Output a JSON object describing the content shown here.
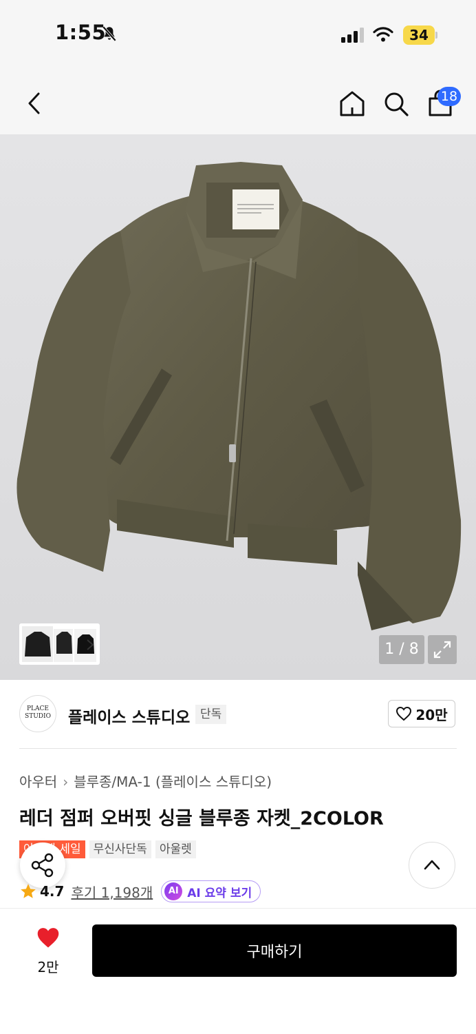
{
  "status_bar": {
    "time": "1:55",
    "battery": "34"
  },
  "nav": {
    "cart_count": "18",
    "icons": [
      "back-icon",
      "home-icon",
      "search-icon",
      "cart-icon"
    ]
  },
  "gallery": {
    "counter": "1 / 8"
  },
  "brand": {
    "name": "플레이스 스튜디오",
    "tag": "단독",
    "likes": "20만",
    "logo_text": "PLACE STUDIO"
  },
  "breadcrumb": {
    "category": "아우터",
    "subcategory": "블루종/MA-1 (플레이스 스튜디오)"
  },
  "product": {
    "title": "레더 점퍼 오버핏 싱글 블루종 자켓_2COLOR",
    "tags": [
      "아울렛 세일",
      "무신사단독",
      "아울렛"
    ],
    "rating": "4.7",
    "reviews": "후기 1,198개",
    "ai_label": "AI",
    "ai_summary": "AI 요약 보기"
  },
  "bottom": {
    "wish_count": "2만",
    "buy_label": "구매하기"
  },
  "colors": {
    "badge": "#2f6bff",
    "sale": "#ff5b3a",
    "heart": "#e8202b",
    "ai": "#6b3ce9"
  }
}
